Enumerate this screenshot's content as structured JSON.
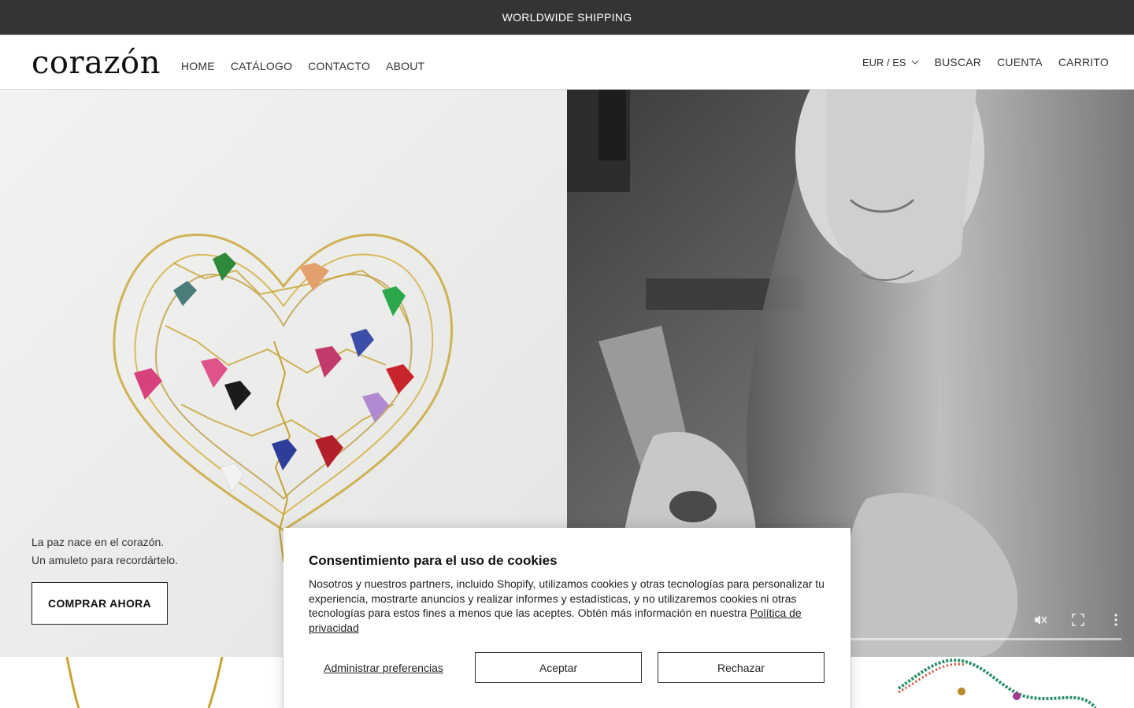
{
  "announcement": {
    "text": "WORLDWIDE SHIPPING"
  },
  "header": {
    "logo": "corazón",
    "nav": [
      "HOME",
      "CATÁLOGO",
      "CONTACTO",
      "ABOUT"
    ],
    "currency": "EUR / ES",
    "right_links": [
      "BUSCAR",
      "CUENTA",
      "CARRITO"
    ]
  },
  "hero": {
    "line1": "La paz nace en el corazón.",
    "line2": "Un amuleto para recordártelo.",
    "button": "COMPRAR AHORA"
  },
  "cookie": {
    "title": "Consentimiento para el uso de cookies",
    "body": "Nosotros y nuestros partners, incluido Shopify, utilizamos cookies y otras tecnologías para personalizar tu experiencia, mostrarte anuncios y realizar informes y estadísticas, y no utilizaremos cookies ni otras tecnologías para estos fines a menos que las aceptes. Obtén más información en nuestra",
    "link": "Política de privacidad",
    "manage": "Administrar preferencias",
    "accept": "Aceptar",
    "reject": "Rechazar"
  },
  "video": {
    "icons": [
      "muted-icon",
      "fullscreen-icon",
      "more-options-icon"
    ]
  }
}
